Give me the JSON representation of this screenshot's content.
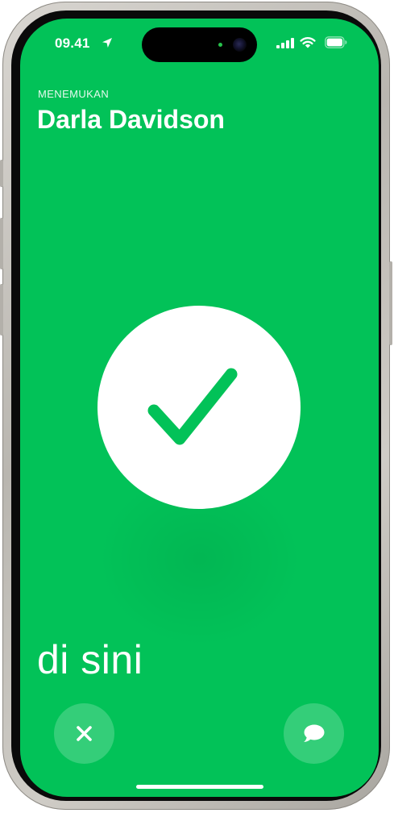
{
  "status_bar": {
    "time": "09.41",
    "location_icon": "location-arrow-icon",
    "signal_icon": "cellular-signal-icon",
    "wifi_icon": "wifi-icon",
    "battery_icon": "battery-icon"
  },
  "header": {
    "subtitle": "MENEMUKAN",
    "name": "Darla Davidson"
  },
  "status": {
    "icon": "checkmark-icon",
    "text": "di sini"
  },
  "actions": {
    "close_icon": "close-icon",
    "message_icon": "message-bubble-icon"
  },
  "colors": {
    "background": "#02c258",
    "foreground": "#ffffff",
    "check": "#02c258"
  }
}
